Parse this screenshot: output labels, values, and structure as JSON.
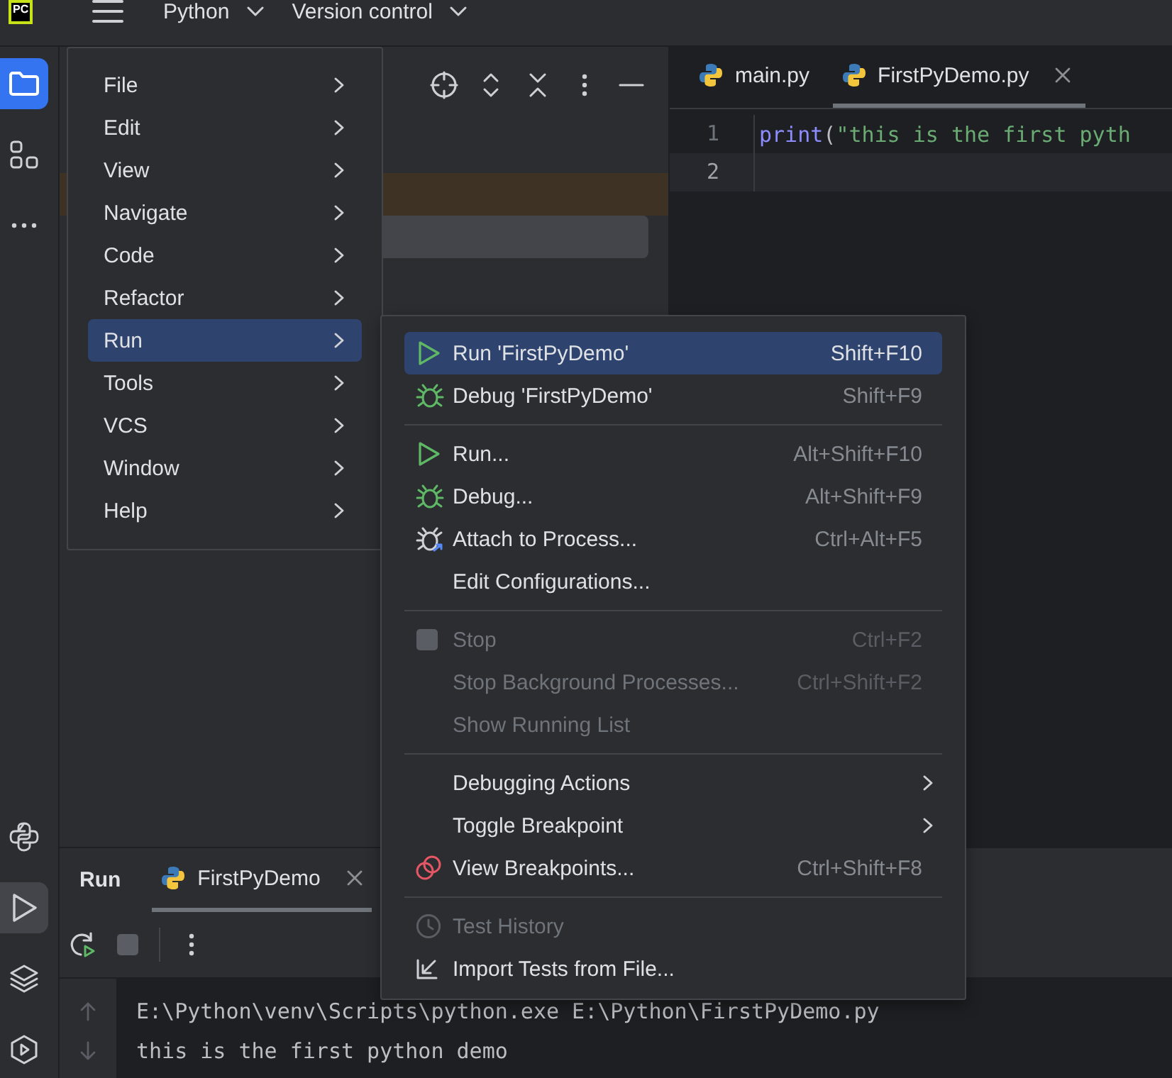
{
  "toolbar": {
    "logo": {
      "text": "PC"
    },
    "menus": [
      {
        "label": "Python"
      },
      {
        "label": "Version control"
      }
    ]
  },
  "left_stripe": {
    "top": [
      {
        "kind": "folder",
        "selected": true
      },
      {
        "kind": "structure",
        "selected": false
      },
      {
        "kind": "more",
        "selected": false
      }
    ],
    "bottom": [
      {
        "kind": "python",
        "selected": false
      },
      {
        "kind": "run",
        "selected": true
      },
      {
        "kind": "layers",
        "selected": false
      },
      {
        "kind": "services",
        "selected": false
      }
    ]
  },
  "project_panel": {
    "tools": [
      {
        "kind": "target"
      },
      {
        "kind": "expand"
      },
      {
        "kind": "collapse"
      },
      {
        "kind": "more"
      },
      {
        "kind": "minimize"
      }
    ]
  },
  "editor": {
    "tabs": [
      {
        "label": "main.py",
        "selected": false,
        "closable": false
      },
      {
        "label": "FirstPyDemo.py",
        "selected": true,
        "closable": true
      }
    ],
    "lines": [
      {
        "number": "1",
        "current": false,
        "tokens": [
          {
            "kind": "function",
            "text": "print"
          },
          {
            "kind": "paren",
            "text": "("
          },
          {
            "kind": "string",
            "text": "\"this is the first pyth"
          }
        ]
      },
      {
        "number": "2",
        "current": true
      }
    ]
  },
  "main_menu": {
    "items": [
      {
        "label": "File",
        "selected": false,
        "submenu": true
      },
      {
        "label": "Edit",
        "selected": false,
        "submenu": true
      },
      {
        "label": "View",
        "selected": false,
        "submenu": true
      },
      {
        "label": "Navigate",
        "selected": false,
        "submenu": true
      },
      {
        "label": "Code",
        "selected": false,
        "submenu": true
      },
      {
        "label": "Refactor",
        "selected": false,
        "submenu": true
      },
      {
        "label": "Run",
        "selected": true,
        "submenu": true
      },
      {
        "label": "Tools",
        "selected": false,
        "submenu": true
      },
      {
        "label": "VCS",
        "selected": false,
        "submenu": true
      },
      {
        "label": "Window",
        "selected": false,
        "submenu": true
      },
      {
        "label": "Help",
        "selected": false,
        "submenu": true
      }
    ]
  },
  "run_menu": {
    "sections": [
      [
        {
          "label": "Run 'FirstPyDemo'",
          "shortcut": "Shift+F10",
          "kind": "play",
          "selected": true,
          "disabled": false,
          "submenu": false
        },
        {
          "label": "Debug 'FirstPyDemo'",
          "shortcut": "Shift+F9",
          "kind": "bug",
          "selected": false,
          "disabled": false,
          "submenu": false
        }
      ],
      [
        {
          "label": "Run...",
          "shortcut": "Alt+Shift+F10",
          "kind": "play",
          "selected": false,
          "disabled": false,
          "submenu": false
        },
        {
          "label": "Debug...",
          "shortcut": "Alt+Shift+F9",
          "kind": "bug",
          "selected": false,
          "disabled": false,
          "submenu": false
        },
        {
          "label": "Attach to Process...",
          "shortcut": "Ctrl+Alt+F5",
          "kind": "attach",
          "selected": false,
          "disabled": false,
          "submenu": false
        },
        {
          "label": "Edit Configurations...",
          "kind": "plain",
          "selected": false,
          "disabled": false,
          "submenu": false
        }
      ],
      [
        {
          "label": "Stop",
          "shortcut": "Ctrl+F2",
          "kind": "stop",
          "selected": false,
          "disabled": true,
          "submenu": false
        },
        {
          "label": "Stop Background Processes...",
          "shortcut": "Ctrl+Shift+F2",
          "kind": "plain",
          "selected": false,
          "disabled": true,
          "submenu": false
        },
        {
          "label": "Show Running List",
          "kind": "plain",
          "selected": false,
          "disabled": true,
          "submenu": false
        }
      ],
      [
        {
          "label": "Debugging Actions",
          "kind": "plain",
          "selected": false,
          "disabled": false,
          "submenu": true
        },
        {
          "label": "Toggle Breakpoint",
          "kind": "plain",
          "selected": false,
          "disabled": false,
          "submenu": true
        },
        {
          "label": "View Breakpoints...",
          "shortcut": "Ctrl+Shift+F8",
          "kind": "breakpoints",
          "selected": false,
          "disabled": false,
          "submenu": false
        }
      ],
      [
        {
          "label": "Test History",
          "kind": "clock",
          "selected": false,
          "disabled": true,
          "submenu": false
        },
        {
          "label": "Import Tests from File...",
          "kind": "import",
          "selected": false,
          "disabled": false,
          "submenu": false
        }
      ]
    ]
  },
  "run_panel": {
    "title": "Run",
    "tabs": [
      {
        "label": "FirstPyDemo",
        "selected": true,
        "closable": true
      }
    ],
    "tools": [
      {
        "kind": "rerun"
      },
      {
        "kind": "stop"
      },
      {
        "kind": "more"
      }
    ],
    "output": [
      "E:\\Python\\venv\\Scripts\\python.exe E:\\Python\\FirstPyDemo.py",
      "this is the first python demo"
    ]
  }
}
